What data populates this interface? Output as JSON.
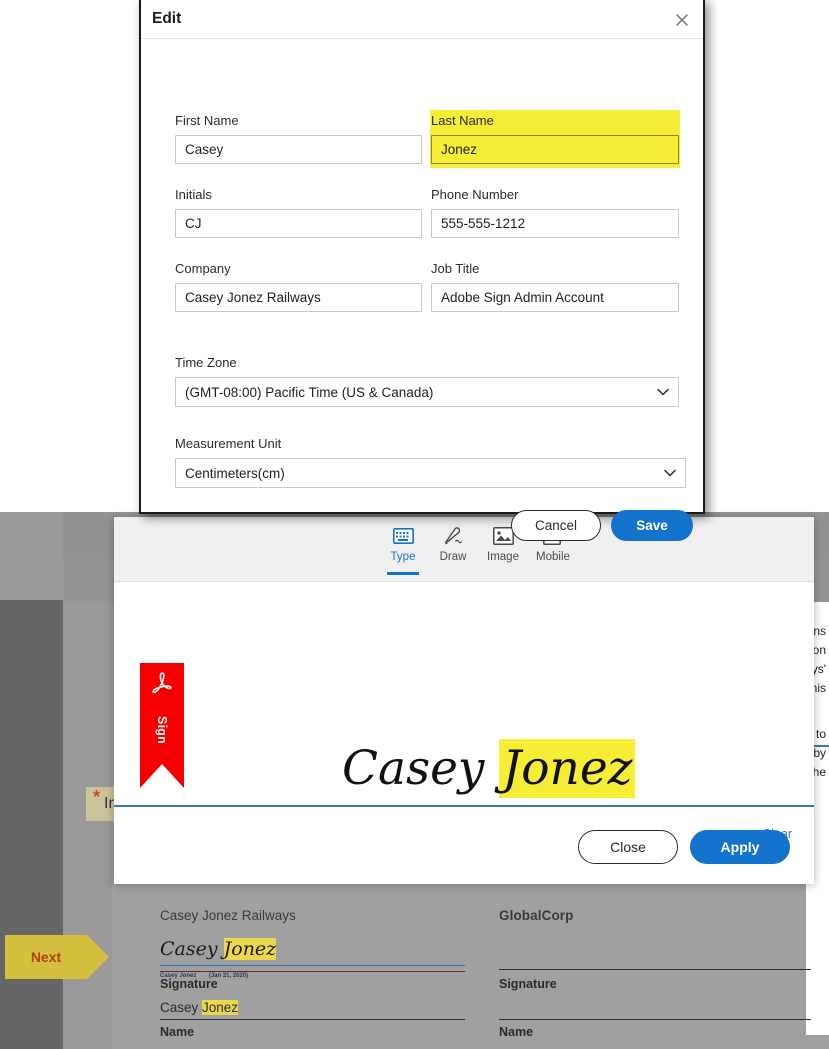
{
  "background": {
    "next_button": {
      "label": "Next"
    },
    "required_field": {
      "marker": "*",
      "text_fragment": "In"
    },
    "page_text_fragments": [
      "ns",
      "on",
      "ys'",
      "nis",
      "to",
      "by",
      "he"
    ],
    "document": {
      "left_block": {
        "company": "Casey Jonez Railways",
        "signature_script": "Casey ",
        "signature_script_highlight": "Jonez",
        "signature_meta_name": "Casey Jonez",
        "signature_meta_date": "(Jan 21, 2020)",
        "signature_label": "Signature",
        "name_value_plain": "Casey ",
        "name_value_highlight": "Jonez",
        "name_label": "Name"
      },
      "right_block": {
        "company": "GlobalCorp",
        "signature_label": "Signature",
        "name_label": "Name"
      }
    }
  },
  "edit_dialog": {
    "title": "Edit",
    "close_icon": "close-icon",
    "fields": {
      "first_name": {
        "label": "First Name",
        "value": "Casey",
        "placeholder": ""
      },
      "last_name": {
        "label": "Last Name",
        "value": "Jonez",
        "placeholder": "",
        "highlighted": true
      },
      "initials": {
        "label": "Initials",
        "value": "CJ",
        "placeholder": ""
      },
      "phone_number": {
        "label": "Phone Number",
        "value": "555-555-1212",
        "placeholder": ""
      },
      "company": {
        "label": "Company",
        "value": "Casey Jonez Railways",
        "placeholder": ""
      },
      "job_title": {
        "label": "Job Title",
        "value": "Adobe Sign Admin Account",
        "placeholder": ""
      },
      "time_zone": {
        "label": "Time Zone",
        "value": "(GMT-08:00) Pacific Time (US & Canada)",
        "options": [
          "(GMT-08:00) Pacific Time (US & Canada)"
        ]
      },
      "measurement_unit": {
        "label": "Measurement Unit",
        "value": "Centimeters(cm)",
        "options": [
          "Centimeters(cm)"
        ]
      }
    },
    "buttons": {
      "cancel": "Cancel",
      "save": "Save"
    }
  },
  "signature_dialog": {
    "tabs": [
      {
        "label": "Type",
        "icon": "keyboard-icon",
        "active": true
      },
      {
        "label": "Draw",
        "icon": "pen-icon",
        "active": false
      },
      {
        "label": "Image",
        "icon": "image-icon",
        "active": false
      },
      {
        "label": "Mobile",
        "icon": "mobile-icon",
        "active": false
      }
    ],
    "sign_tag": {
      "word": "Sign",
      "icon": "adobe-pdf-icon"
    },
    "signature_text_plain": "Casey ",
    "signature_text_highlight": "Jonez",
    "clear_link": "Clear",
    "buttons": {
      "close": "Close",
      "apply": "Apply"
    }
  },
  "colors": {
    "accent_blue": "#1473cc",
    "link_blue": "#2e7bbf",
    "highlight_yellow": "#f7ec36",
    "highlight_olive": "#e8d84a",
    "sign_tag_red": "#f40000",
    "next_flag": "#d4bf3f",
    "signature_rule_blue": "#3a76b0"
  }
}
